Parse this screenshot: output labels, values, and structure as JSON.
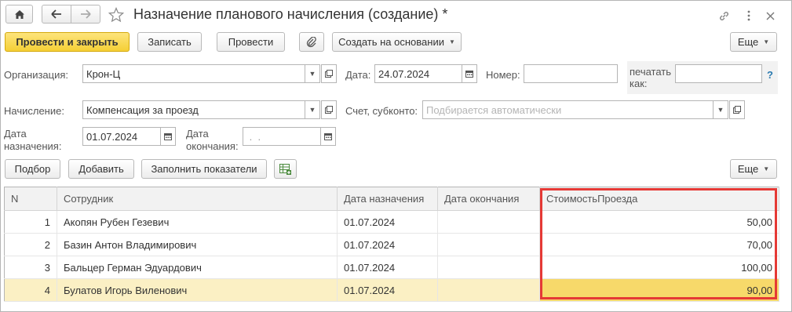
{
  "window": {
    "title": "Назначение планового начисления (создание) *",
    "home_icon": "home-icon",
    "back_icon": "arrow-left-icon",
    "forward_icon": "arrow-right-icon",
    "star_icon": "star-icon",
    "link_icon": "link-icon",
    "menu_icon": "more-vertical-icon",
    "close_icon": "close-icon"
  },
  "toolbar": {
    "post_close": "Провести и закрыть",
    "save": "Записать",
    "post": "Провести",
    "attach_icon": "paperclip-icon",
    "create_based": "Создать на основании",
    "more": "Еще"
  },
  "form": {
    "org_label": "Организация:",
    "org_value": "Крон-Ц",
    "date_label": "Дата:",
    "date_value": "24.07.2024",
    "number_label": "Номер:",
    "number_value": "",
    "print_label_1": "печатать",
    "print_label_2": "как:",
    "print_value": "",
    "help": "?",
    "accrual_label": "Начисление:",
    "accrual_value": "Компенсация за проезд",
    "account_label": "Счет, субконто:",
    "account_placeholder": "Подбирается автоматически",
    "assign_date_label_1": "Дата",
    "assign_date_label_2": "назначения:",
    "assign_date_value": "01.07.2024",
    "end_date_label_1": "Дата",
    "end_date_label_2": "окончания:",
    "end_date_value": " .  ."
  },
  "table_toolbar": {
    "pick": "Подбор",
    "add": "Добавить",
    "fill": "Заполнить показатели",
    "table_icon": "table-add-icon",
    "more": "Еще"
  },
  "table": {
    "headers": [
      "N",
      "Сотрудник",
      "Дата назначения",
      "Дата окончания",
      "СтоимостьПроезда"
    ],
    "rows": [
      {
        "n": "1",
        "employee": "Акопян Рубен Гезевич",
        "start": "01.07.2024",
        "end": "",
        "cost": "50,00"
      },
      {
        "n": "2",
        "employee": "Базин Антон Владимирович",
        "start": "01.07.2024",
        "end": "",
        "cost": "70,00"
      },
      {
        "n": "3",
        "employee": "Бальцер Герман Эдуардович",
        "start": "01.07.2024",
        "end": "",
        "cost": "100,00"
      },
      {
        "n": "4",
        "employee": "Булатов Игорь Виленович",
        "start": "01.07.2024",
        "end": "",
        "cost": "90,00"
      }
    ],
    "selected_row": 4
  },
  "colors": {
    "primary_button": "#f5cf35",
    "selected_row": "#fbf0c4",
    "selected_cell": "#f7d96a",
    "highlight_frame": "#e53935"
  }
}
